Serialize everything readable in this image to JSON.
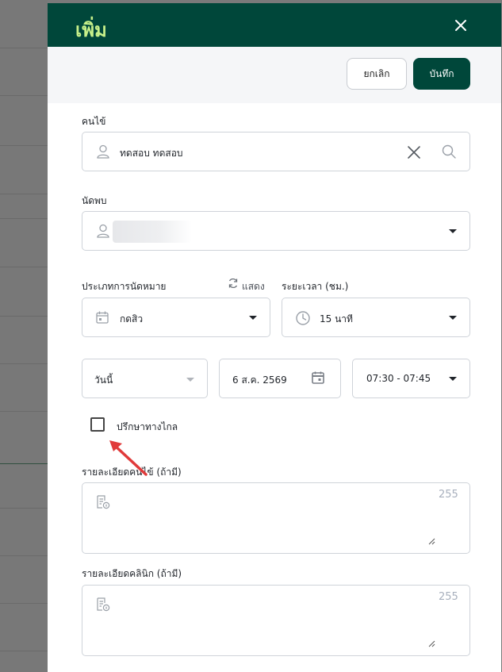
{
  "drawer": {
    "title": "เพิ่ม",
    "close_icon": "close-icon"
  },
  "actions": {
    "cancel_label": "ยกเลิก",
    "save_label": "บันทึก"
  },
  "patient": {
    "label": "คนไข้",
    "value": "ทดสอบ ทดสอบ",
    "icons": [
      "user-icon",
      "clear-icon",
      "search-icon"
    ]
  },
  "appointment_with": {
    "label": "นัดพบ",
    "value": "",
    "icons": [
      "user-icon",
      "chevron-down-icon"
    ]
  },
  "appointment_type": {
    "label": "ประเภทการนัดหมาย",
    "toggle_label": "แสดง",
    "value": "กดสิว",
    "icons": [
      "calendar-icon",
      "refresh-icon",
      "chevron-down-icon"
    ]
  },
  "duration": {
    "label": "ระยะเวลา (ชม.)",
    "value": "15 นาที",
    "icons": [
      "clock-icon",
      "chevron-down-icon"
    ]
  },
  "date_preset": {
    "value": "วันนี้"
  },
  "date": {
    "value": "6 ส.ค. 2569",
    "icons": [
      "calendar-icon"
    ]
  },
  "time_slot": {
    "value": "07:30 - 07:45"
  },
  "telemedicine": {
    "label": "ปรึกษาทางไกล",
    "checked": false
  },
  "patient_details": {
    "label": "รายละเอียดคนไข้ (ถ้ามี)",
    "counter": "255",
    "value": ""
  },
  "clinic_details": {
    "label": "รายละเอียดคลินิก (ถ้ามี)",
    "counter": "255",
    "value": ""
  },
  "colors": {
    "header_bg": "#00473a",
    "title_color": "#c7f08a",
    "annotation_arrow": "#e03a3a"
  }
}
